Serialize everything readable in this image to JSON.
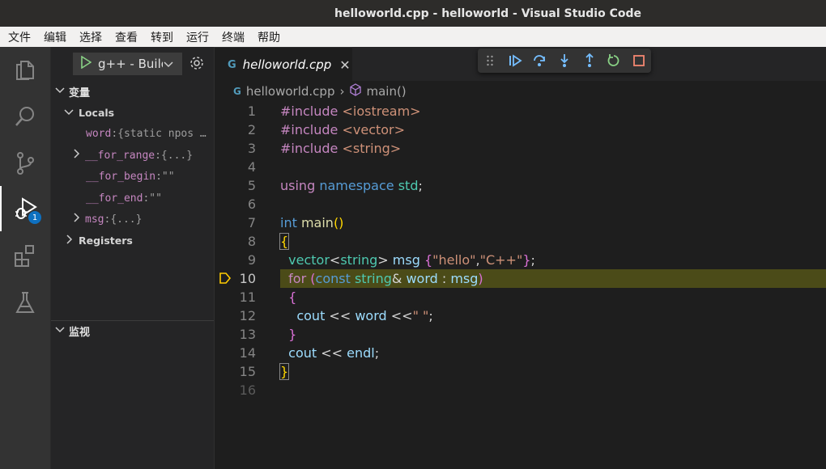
{
  "window": {
    "title": "helloworld.cpp - helloworld - Visual Studio Code"
  },
  "menu": [
    "文件",
    "编辑",
    "选择",
    "查看",
    "转到",
    "运行",
    "终端",
    "帮助"
  ],
  "activity": {
    "debug_badge": "1",
    "items": [
      "explorer-icon",
      "search-icon",
      "source-control-icon",
      "run-debug-icon",
      "extensions-icon",
      "testing-icon"
    ]
  },
  "sidebar": {
    "launch_config": "g++ - Build and debug active file",
    "variables_title": "变量",
    "locals_label": "Locals",
    "locals": [
      {
        "name": "word",
        "value": "{static npos …",
        "expandable": false
      },
      {
        "name": "__for_range",
        "value": "{...}",
        "expandable": true
      },
      {
        "name": "__for_begin",
        "value": "\"\"",
        "expandable": false
      },
      {
        "name": "__for_end",
        "value": "\"\"",
        "expandable": false
      },
      {
        "name": "msg",
        "value": "{...}",
        "expandable": true
      }
    ],
    "registers_label": "Registers",
    "watch_title": "监视"
  },
  "editor": {
    "tab_icon": "G",
    "tab_name": "helloworld.cpp",
    "breadcrumb_file": "helloworld.cpp",
    "breadcrumb_symbol": "main()",
    "current_line": 10,
    "line_numbers": [
      "1",
      "2",
      "3",
      "4",
      "5",
      "6",
      "7",
      "8",
      "9",
      "10",
      "11",
      "12",
      "13",
      "14",
      "15",
      "16"
    ]
  },
  "colors": {
    "current_line_bg": "#4b4b18",
    "breakpoint_arrow": "#ffcc00",
    "accent": "#0e70c0"
  }
}
